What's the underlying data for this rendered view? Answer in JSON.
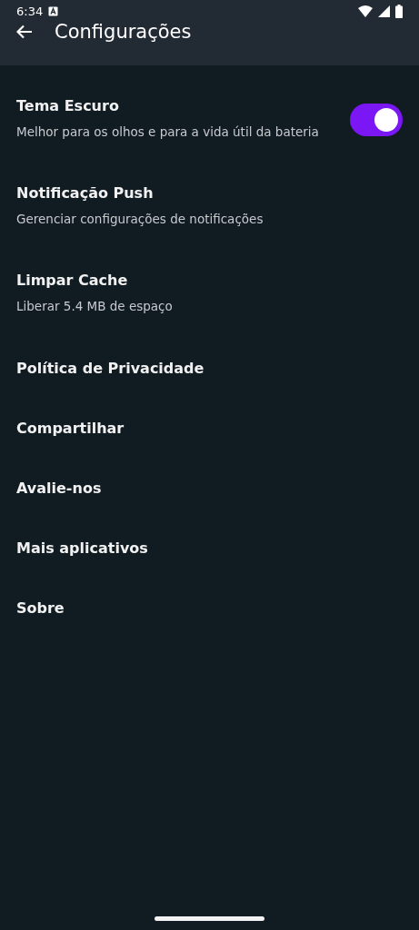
{
  "status_bar": {
    "time": "6:34"
  },
  "app_bar": {
    "title": "Configurações"
  },
  "settings": [
    {
      "kind": "toggle",
      "title": "Tema Escuro",
      "subtitle": "Melhor para os olhos e para a vida útil da bateria",
      "on": true
    },
    {
      "kind": "plain",
      "title": "Notificação Push",
      "subtitle": "Gerenciar configurações de notificações"
    },
    {
      "kind": "plain",
      "title": "Limpar Cache",
      "subtitle": "Liberar 5.4 MB de espaço"
    },
    {
      "kind": "plain",
      "title": "Política de Privacidade"
    },
    {
      "kind": "plain",
      "title": "Compartilhar"
    },
    {
      "kind": "plain",
      "title": "Avalie-nos"
    },
    {
      "kind": "plain",
      "title": "Mais aplicativos"
    },
    {
      "kind": "plain",
      "title": "Sobre"
    }
  ]
}
